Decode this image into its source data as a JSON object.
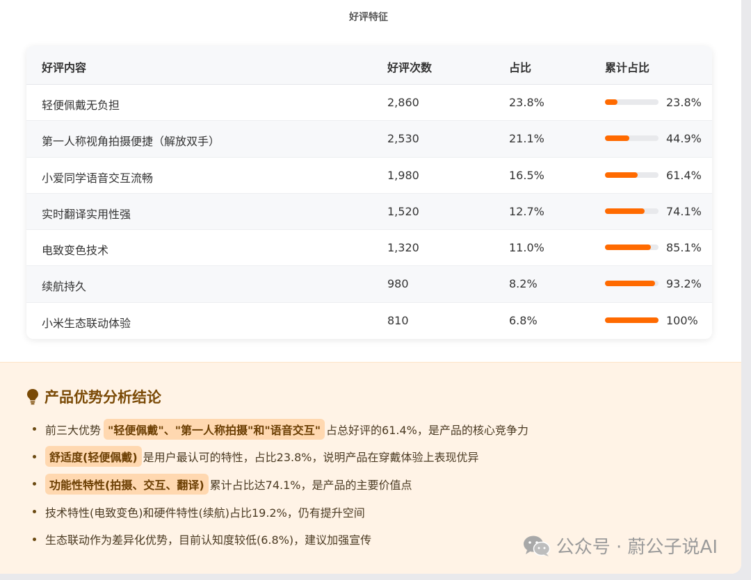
{
  "caption": "好评特征",
  "table": {
    "headers": [
      "好评内容",
      "好评次数",
      "占比",
      "累计占比"
    ],
    "rows": [
      {
        "content": "轻便佩戴无负担",
        "count": "2,860",
        "share": "23.8%",
        "cumulative": "23.8%",
        "cum_fraction": 0.238
      },
      {
        "content": "第一人称视角拍摄便捷（解放双手）",
        "count": "2,530",
        "share": "21.1%",
        "cumulative": "44.9%",
        "cum_fraction": 0.449
      },
      {
        "content": "小爱同学语音交互流畅",
        "count": "1,980",
        "share": "16.5%",
        "cumulative": "61.4%",
        "cum_fraction": 0.614
      },
      {
        "content": "实时翻译实用性强",
        "count": "1,520",
        "share": "12.7%",
        "cumulative": "74.1%",
        "cum_fraction": 0.741
      },
      {
        "content": "电致变色技术",
        "count": "1,320",
        "share": "11.0%",
        "cumulative": "85.1%",
        "cum_fraction": 0.851
      },
      {
        "content": "续航持久",
        "count": "980",
        "share": "8.2%",
        "cumulative": "93.2%",
        "cum_fraction": 0.932
      },
      {
        "content": "小米生态联动体验",
        "count": "810",
        "share": "6.8%",
        "cumulative": "100%",
        "cum_fraction": 1.0
      }
    ],
    "bar_color": "#ff6a00"
  },
  "conclusion": {
    "icon": "lightbulb-icon",
    "title": "产品优势分析结论",
    "points": [
      {
        "highlight": "\"轻便佩戴\"、\"第一人称拍摄\"和\"语音交互\"",
        "prefix": "前三大优势",
        "suffix": "占总好评的61.4%，是产品的核心竞争力"
      },
      {
        "highlight": "舒适度(轻便佩戴)",
        "prefix": "",
        "suffix": "是用户最认可的特性，占比23.8%，说明产品在穿戴体验上表现优异"
      },
      {
        "highlight": "功能性特性(拍摄、交互、翻译)",
        "prefix": "",
        "suffix": "累计占比达74.1%，是产品的主要价值点"
      },
      {
        "highlight": "",
        "prefix": "技术特性(电致变色)和硬件特性(续航)占比19.2%，仍有提升空间",
        "suffix": ""
      },
      {
        "highlight": "",
        "prefix": "生态联动作为差异化优势，目前认知度较低(6.8%)，建议加强宣传",
        "suffix": ""
      }
    ]
  },
  "watermark": "公众号 · 蔚公子说AI"
}
